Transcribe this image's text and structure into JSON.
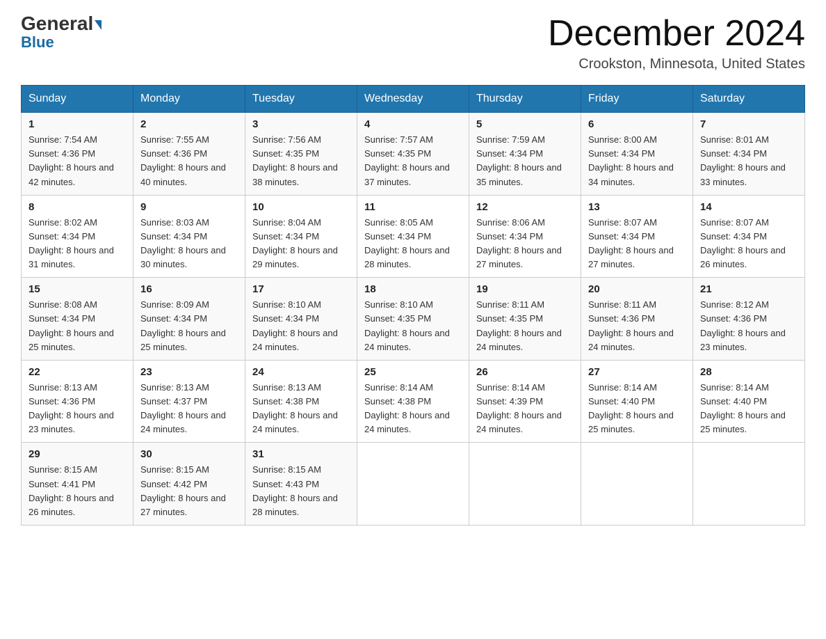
{
  "header": {
    "logo_general": "General",
    "logo_blue": "Blue",
    "title": "December 2024",
    "subtitle": "Crookston, Minnesota, United States"
  },
  "weekdays": [
    "Sunday",
    "Monday",
    "Tuesday",
    "Wednesday",
    "Thursday",
    "Friday",
    "Saturday"
  ],
  "weeks": [
    [
      {
        "day": "1",
        "sunrise": "7:54 AM",
        "sunset": "4:36 PM",
        "daylight": "8 hours and 42 minutes."
      },
      {
        "day": "2",
        "sunrise": "7:55 AM",
        "sunset": "4:36 PM",
        "daylight": "8 hours and 40 minutes."
      },
      {
        "day": "3",
        "sunrise": "7:56 AM",
        "sunset": "4:35 PM",
        "daylight": "8 hours and 38 minutes."
      },
      {
        "day": "4",
        "sunrise": "7:57 AM",
        "sunset": "4:35 PM",
        "daylight": "8 hours and 37 minutes."
      },
      {
        "day": "5",
        "sunrise": "7:59 AM",
        "sunset": "4:34 PM",
        "daylight": "8 hours and 35 minutes."
      },
      {
        "day": "6",
        "sunrise": "8:00 AM",
        "sunset": "4:34 PM",
        "daylight": "8 hours and 34 minutes."
      },
      {
        "day": "7",
        "sunrise": "8:01 AM",
        "sunset": "4:34 PM",
        "daylight": "8 hours and 33 minutes."
      }
    ],
    [
      {
        "day": "8",
        "sunrise": "8:02 AM",
        "sunset": "4:34 PM",
        "daylight": "8 hours and 31 minutes."
      },
      {
        "day": "9",
        "sunrise": "8:03 AM",
        "sunset": "4:34 PM",
        "daylight": "8 hours and 30 minutes."
      },
      {
        "day": "10",
        "sunrise": "8:04 AM",
        "sunset": "4:34 PM",
        "daylight": "8 hours and 29 minutes."
      },
      {
        "day": "11",
        "sunrise": "8:05 AM",
        "sunset": "4:34 PM",
        "daylight": "8 hours and 28 minutes."
      },
      {
        "day": "12",
        "sunrise": "8:06 AM",
        "sunset": "4:34 PM",
        "daylight": "8 hours and 27 minutes."
      },
      {
        "day": "13",
        "sunrise": "8:07 AM",
        "sunset": "4:34 PM",
        "daylight": "8 hours and 27 minutes."
      },
      {
        "day": "14",
        "sunrise": "8:07 AM",
        "sunset": "4:34 PM",
        "daylight": "8 hours and 26 minutes."
      }
    ],
    [
      {
        "day": "15",
        "sunrise": "8:08 AM",
        "sunset": "4:34 PM",
        "daylight": "8 hours and 25 minutes."
      },
      {
        "day": "16",
        "sunrise": "8:09 AM",
        "sunset": "4:34 PM",
        "daylight": "8 hours and 25 minutes."
      },
      {
        "day": "17",
        "sunrise": "8:10 AM",
        "sunset": "4:34 PM",
        "daylight": "8 hours and 24 minutes."
      },
      {
        "day": "18",
        "sunrise": "8:10 AM",
        "sunset": "4:35 PM",
        "daylight": "8 hours and 24 minutes."
      },
      {
        "day": "19",
        "sunrise": "8:11 AM",
        "sunset": "4:35 PM",
        "daylight": "8 hours and 24 minutes."
      },
      {
        "day": "20",
        "sunrise": "8:11 AM",
        "sunset": "4:36 PM",
        "daylight": "8 hours and 24 minutes."
      },
      {
        "day": "21",
        "sunrise": "8:12 AM",
        "sunset": "4:36 PM",
        "daylight": "8 hours and 23 minutes."
      }
    ],
    [
      {
        "day": "22",
        "sunrise": "8:13 AM",
        "sunset": "4:36 PM",
        "daylight": "8 hours and 23 minutes."
      },
      {
        "day": "23",
        "sunrise": "8:13 AM",
        "sunset": "4:37 PM",
        "daylight": "8 hours and 24 minutes."
      },
      {
        "day": "24",
        "sunrise": "8:13 AM",
        "sunset": "4:38 PM",
        "daylight": "8 hours and 24 minutes."
      },
      {
        "day": "25",
        "sunrise": "8:14 AM",
        "sunset": "4:38 PM",
        "daylight": "8 hours and 24 minutes."
      },
      {
        "day": "26",
        "sunrise": "8:14 AM",
        "sunset": "4:39 PM",
        "daylight": "8 hours and 24 minutes."
      },
      {
        "day": "27",
        "sunrise": "8:14 AM",
        "sunset": "4:40 PM",
        "daylight": "8 hours and 25 minutes."
      },
      {
        "day": "28",
        "sunrise": "8:14 AM",
        "sunset": "4:40 PM",
        "daylight": "8 hours and 25 minutes."
      }
    ],
    [
      {
        "day": "29",
        "sunrise": "8:15 AM",
        "sunset": "4:41 PM",
        "daylight": "8 hours and 26 minutes."
      },
      {
        "day": "30",
        "sunrise": "8:15 AM",
        "sunset": "4:42 PM",
        "daylight": "8 hours and 27 minutes."
      },
      {
        "day": "31",
        "sunrise": "8:15 AM",
        "sunset": "4:43 PM",
        "daylight": "8 hours and 28 minutes."
      },
      null,
      null,
      null,
      null
    ]
  ],
  "labels": {
    "sunrise_prefix": "Sunrise: ",
    "sunset_prefix": "Sunset: ",
    "daylight_prefix": "Daylight: "
  }
}
